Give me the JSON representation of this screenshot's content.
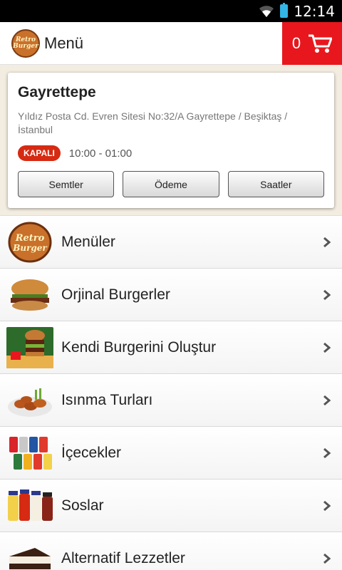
{
  "status_bar": {
    "time": "12:14"
  },
  "app_bar": {
    "title": "Menü",
    "logo_text_1": "Retro",
    "logo_text_2": "Burger",
    "cart_count": "0"
  },
  "branch": {
    "name": "Gayrettepe",
    "address": "Yıldız Posta Cd. Evren Sitesi No:32/A Gayrettepe / Beşiktaş / İstanbul",
    "status": "KAPALI",
    "hours": "10:00 - 01:00",
    "buttons": [
      "Semtler",
      "Ödeme",
      "Saatler"
    ]
  },
  "menu": {
    "items": [
      {
        "label": "Menüler",
        "icon": "retro-burger-logo-icon"
      },
      {
        "label": "Orjinal Burgerler",
        "icon": "burger-icon"
      },
      {
        "label": "Kendi Burgerini Oluştur",
        "icon": "stacked-burger-icon"
      },
      {
        "label": "Isınma Turları",
        "icon": "chicken-wings-icon"
      },
      {
        "label": "İçecekler",
        "icon": "soda-cans-icon"
      },
      {
        "label": "Soslar",
        "icon": "sauce-bottles-icon"
      },
      {
        "label": "Alternatif Lezzetler",
        "icon": "cake-icon"
      }
    ]
  },
  "colors": {
    "accent": "#e8171d",
    "badge": "#d62a12"
  }
}
